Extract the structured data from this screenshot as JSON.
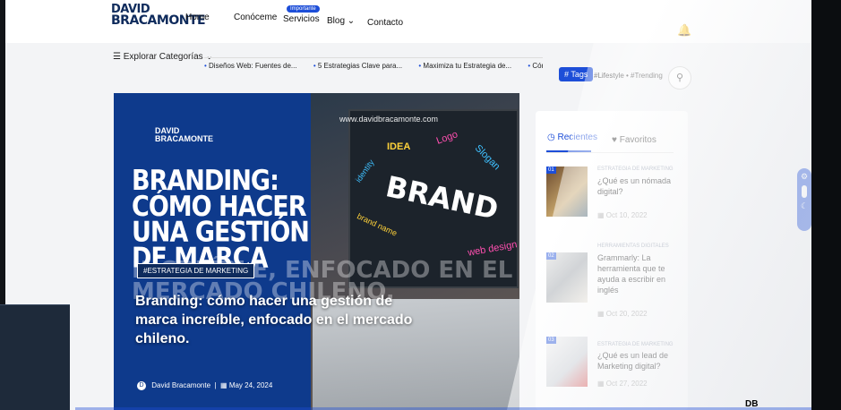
{
  "header": {
    "logo_line1": "DAVID",
    "logo_line2": "BRACAMONTE",
    "nav": [
      "Home",
      "Conóceme",
      "Servicios",
      "Blog",
      "Contacto"
    ],
    "badge": "Importante"
  },
  "toolbar": {
    "explore_label": "Explorar Categorías",
    "ticker": [
      "Diseños Web: Fuentes de...",
      "5 Estrategias Clave para...",
      "Maximiza tu Estrategia de...",
      "Cómo Crear una Pág"
    ],
    "tags_label": "# Tags",
    "tag_links": "#Lifestyle • #Trending"
  },
  "hero": {
    "url": "www.davidbracamonte.com",
    "logo_line1": "DAVID",
    "logo_line2": "BRACAMONTE",
    "title": "BRANDING: CÓMO HACER UNA GESTIÓN DE MARCA",
    "ghost": "INCREÍBLE, ENFOCADO EN EL MERCADO CHILENO.",
    "category": "#ESTRATEGIA DE MARKETING",
    "caption": "Branding: cómo hacer una gestión de marca increíble, enfocado en el mercado chileno.",
    "author": "David Bracamonte",
    "date": "May 24, 2024",
    "image_words": {
      "idea": "IDEA",
      "logo": "Logo",
      "slogan": "Slogan",
      "identity": "identity",
      "brand": "BRAND",
      "brand_name": "brand name",
      "web_design": "web design"
    }
  },
  "sidebar": {
    "tab_recent": "Recientes",
    "tab_favorites": "Favoritos",
    "posts": [
      {
        "num": "01",
        "category": "ESTRATEGIA DE MARKETING",
        "title": "¿Qué es un nómada digital?",
        "date": "Oct 10, 2022"
      },
      {
        "num": "02",
        "category": "HERRAMIENTAS DIGITALES",
        "title": "Grammarly: La herramienta que te ayuda a escribir en inglés",
        "date": "Oct 20, 2022"
      },
      {
        "num": "03",
        "category": "ESTRATEGIA DE MARKETING",
        "title": "¿Qué es un lead de Marketing digital?",
        "date": "Oct 27, 2022"
      }
    ]
  },
  "colors": {
    "accent": "#1d4ed8",
    "hero_bg": "#0e3a8c",
    "logo": "#0f2b5c"
  }
}
